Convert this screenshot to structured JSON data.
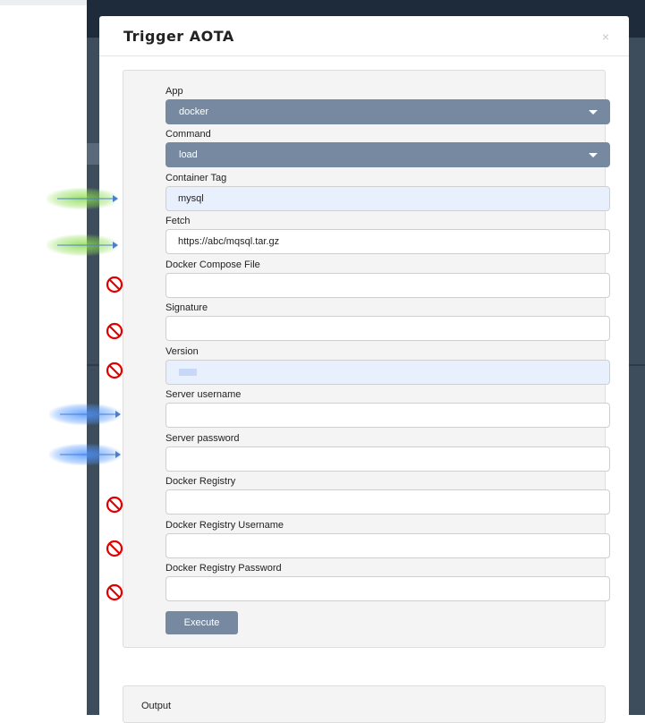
{
  "modal": {
    "title": "Trigger AOTA",
    "close_label": "×"
  },
  "form": {
    "app": {
      "label": "App",
      "value": "docker"
    },
    "command": {
      "label": "Command",
      "value": "load"
    },
    "container_tag": {
      "label": "Container Tag",
      "value": "mysql"
    },
    "fetch": {
      "label": "Fetch",
      "value": "https://abc/mqsql.tar.gz"
    },
    "docker_compose_file": {
      "label": "Docker Compose File",
      "value": ""
    },
    "signature": {
      "label": "Signature",
      "value": ""
    },
    "version": {
      "label": "Version",
      "value": ""
    },
    "server_username": {
      "label": "Server username",
      "value": ""
    },
    "server_password": {
      "label": "Server password",
      "value": ""
    },
    "docker_registry": {
      "label": "Docker Registry",
      "value": ""
    },
    "docker_registry_username": {
      "label": "Docker Registry Username",
      "value": ""
    },
    "docker_registry_password": {
      "label": "Docker Registry Password",
      "value": ""
    },
    "execute_label": "Execute"
  },
  "output": {
    "label": "Output"
  },
  "annotations": {
    "arrow_colors": {
      "required": "#8cdc50",
      "credentials": "#5096ff"
    },
    "not_used_icon": "prohibited-icon",
    "not_used_color": "#e00000"
  }
}
